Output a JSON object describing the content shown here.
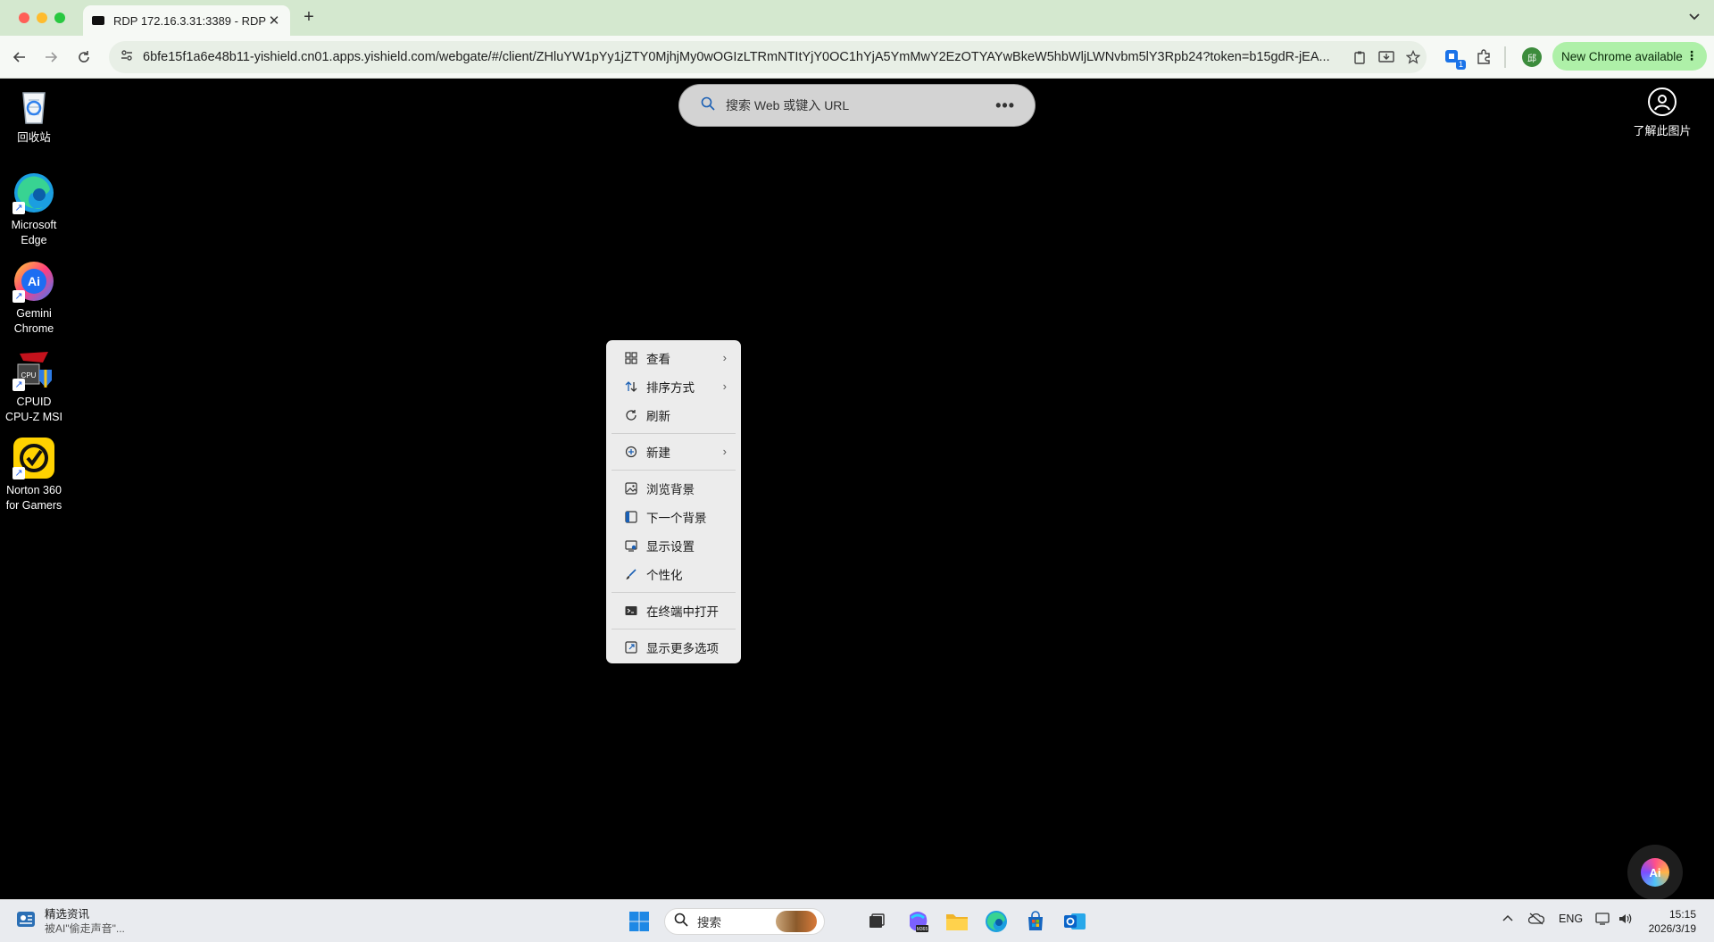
{
  "browser": {
    "tab_title": "RDP 172.16.3.31:3389 - RDP",
    "url": "6bfe15f1a6e48b11-yishield.cn01.apps.yishield.com/webgate/#/client/ZHluYW1pYy1jZTY0MjhjMy0wOGIzLTRmNTItYjY0OC1hYjA5YmMwY2EzOTYAYwBkeW5hbWljLWNvbm5lY3Rpb24?token=b15gdR-jEA...",
    "update_label": "New Chrome available",
    "extension_badge": "1",
    "profile_initial": "邱"
  },
  "desktop": {
    "icons": [
      {
        "label": "回收站"
      },
      {
        "label": "Microsoft Edge"
      },
      {
        "label": "Gemini Chrome"
      },
      {
        "label": "CPUID CPU-Z MSI"
      },
      {
        "label": "Norton 360 for Gamers"
      }
    ],
    "search_placeholder": "搜索 Web 或键入 URL",
    "learn_label": "了解此图片"
  },
  "context_menu": {
    "items": [
      {
        "label": "查看",
        "icon": "grid-icon",
        "submenu": true
      },
      {
        "label": "排序方式",
        "icon": "sort-icon",
        "submenu": true
      },
      {
        "label": "刷新",
        "icon": "refresh-icon",
        "submenu": false
      },
      {
        "label": "新建",
        "icon": "new-plus-icon",
        "submenu": true
      },
      {
        "label": "浏览背景",
        "icon": "image-icon",
        "submenu": false
      },
      {
        "label": "下一个背景",
        "icon": "next-bg-icon",
        "submenu": false
      },
      {
        "label": "显示设置",
        "icon": "display-icon",
        "submenu": false
      },
      {
        "label": "个性化",
        "icon": "brush-icon",
        "submenu": false
      },
      {
        "label": "在终端中打开",
        "icon": "terminal-icon",
        "submenu": false
      },
      {
        "label": "显示更多选项",
        "icon": "more-options-icon",
        "submenu": false
      }
    ]
  },
  "taskbar": {
    "news_title": "精选资讯",
    "news_sub": "被AI\"偷走声音\"...",
    "search_placeholder": "搜索",
    "lang": "ENG",
    "time": "15:15",
    "date": "2026/3/19"
  }
}
